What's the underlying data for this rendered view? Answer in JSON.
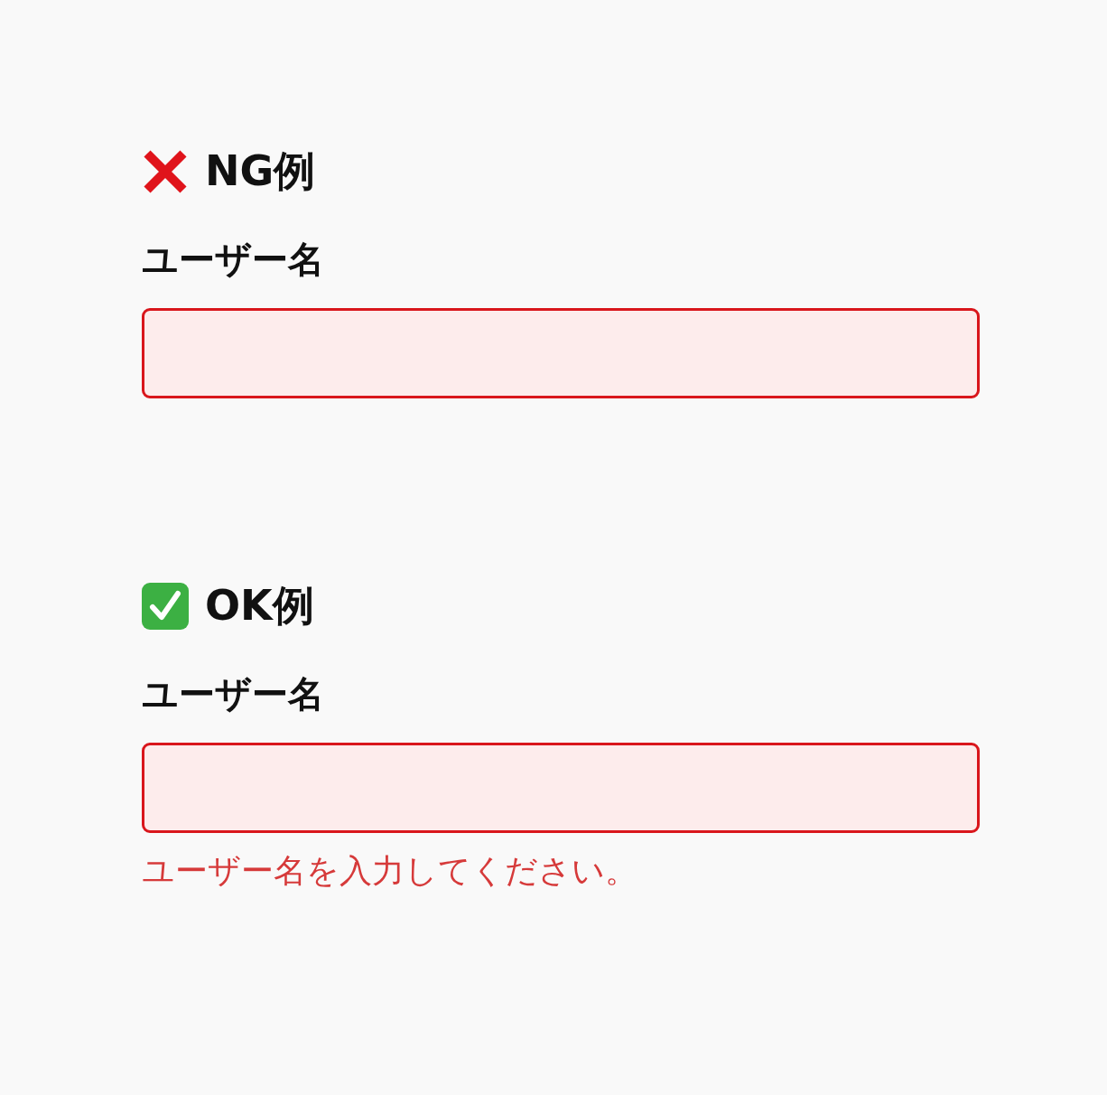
{
  "sections": [
    {
      "kind": "ng",
      "title": "NG例",
      "label": "ユーザー名",
      "field": {
        "error": true
      }
    },
    {
      "kind": "ok",
      "title": "OK例",
      "label": "ユーザー名",
      "field": {
        "error": true
      },
      "message": "ユーザー名を入力してください。"
    }
  ]
}
